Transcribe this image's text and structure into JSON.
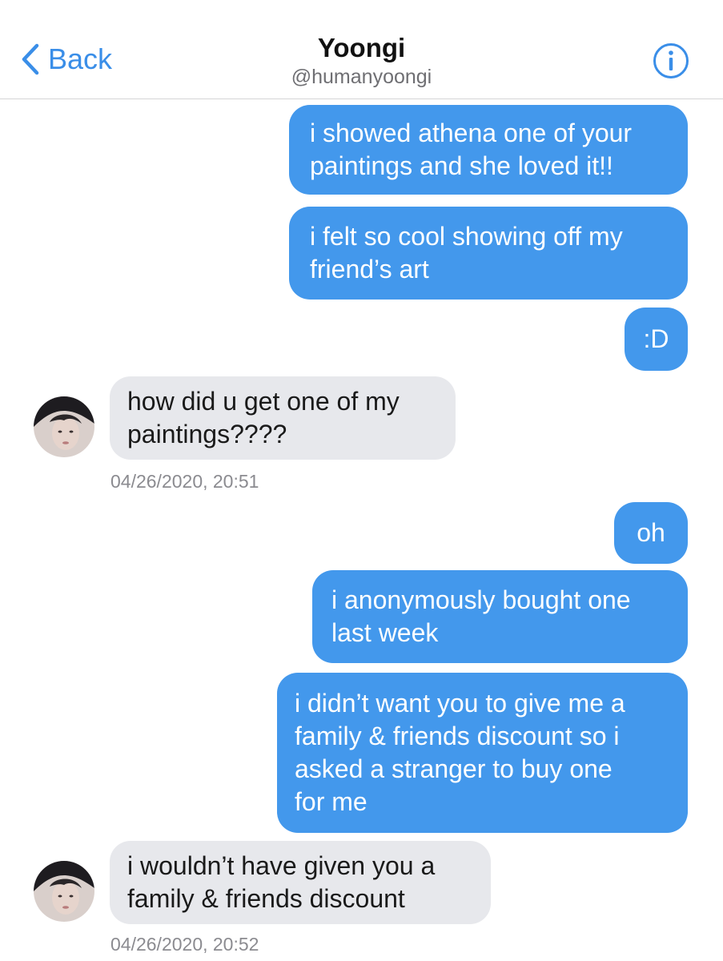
{
  "header": {
    "back_label": "Back",
    "title": "Yoongi",
    "handle": "@humanyoongi"
  },
  "icons": {
    "back": "chevron-left-icon",
    "info": "info-icon",
    "avatar": "contact-avatar"
  },
  "colors": {
    "accent": "#3a8ee8",
    "outgoing_bubble": "#4398ec",
    "incoming_bubble": "#e7e8ec"
  },
  "messages": [
    {
      "direction": "outgoing",
      "text": "i showed athena one of your\npaintings and she loved it!!"
    },
    {
      "direction": "outgoing",
      "text": "i felt so cool showing off my\nfriend’s art"
    },
    {
      "direction": "outgoing",
      "text": ":D"
    },
    {
      "direction": "incoming",
      "text": "how did u get one of my\npaintings????",
      "timestamp": "04/26/2020, 20:51"
    },
    {
      "direction": "outgoing",
      "text": "oh"
    },
    {
      "direction": "outgoing",
      "text": "i anonymously bought one\nlast week"
    },
    {
      "direction": "outgoing",
      "text": "i didn’t want you to give me a\nfamily & friends discount so i\nasked a stranger to buy one\nfor me"
    },
    {
      "direction": "incoming",
      "text": "i wouldn’t have given you a\nfamily & friends discount",
      "timestamp": "04/26/2020, 20:52"
    }
  ]
}
